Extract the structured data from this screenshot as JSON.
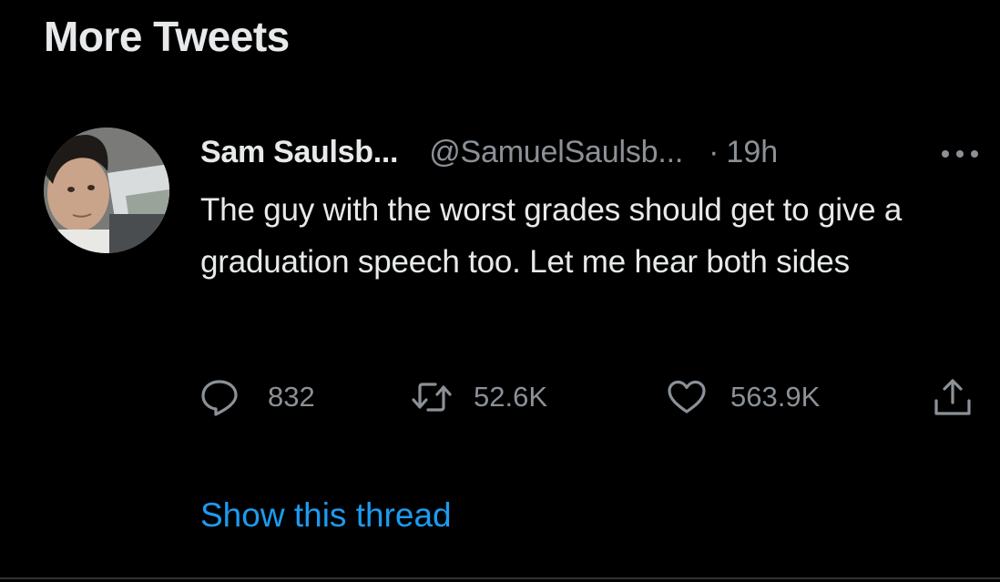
{
  "section": {
    "title": "More Tweets"
  },
  "tweet": {
    "display_name": "Sam Saulsb...",
    "handle": "@SamuelSaulsb...",
    "separator": "·",
    "timestamp": "19h",
    "more_icon": "more-horizontal-icon",
    "text": "The guy with the worst grades should get to give a graduation speech too. Let me hear both sides",
    "actions": {
      "reply": {
        "icon": "reply-icon",
        "count": "832"
      },
      "retweet": {
        "icon": "retweet-icon",
        "count": "52.6K"
      },
      "like": {
        "icon": "heart-icon",
        "count": "563.9K"
      },
      "share": {
        "icon": "share-icon"
      }
    },
    "show_thread_label": "Show this thread"
  },
  "colors": {
    "background": "#000000",
    "primary_text": "#e7e9ea",
    "secondary_text": "#8b9197",
    "link": "#1d9bf0",
    "divider": "#2f3336"
  }
}
